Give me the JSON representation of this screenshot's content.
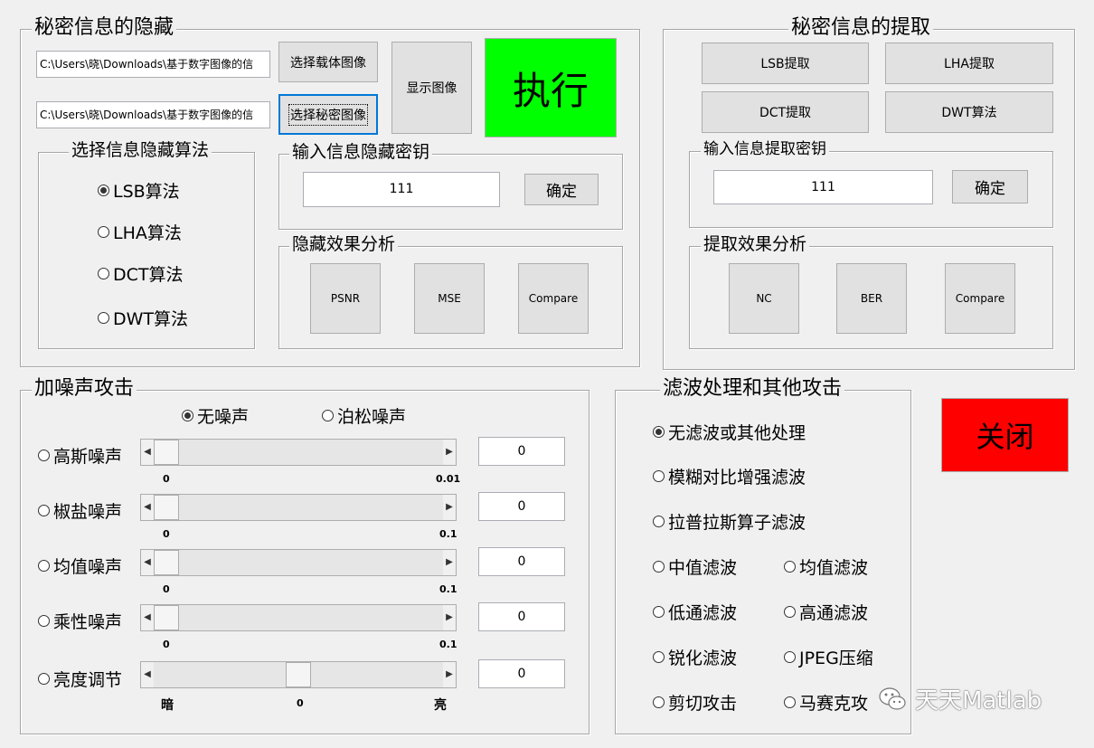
{
  "hide_panel": {
    "title": "秘密信息的隐藏",
    "carrier_path": "C:\\Users\\晓\\Downloads\\基于数字图像的信",
    "secret_path": "C:\\Users\\晓\\Downloads\\基于数字图像的信",
    "select_carrier_label": "选择载体图像",
    "select_secret_label": "选择秘密图像",
    "show_image_label": "显示图像",
    "execute_label": "执行",
    "algo_group": {
      "title": "选择信息隐藏算法",
      "options": [
        "LSB算法",
        "LHA算法",
        "DCT算法",
        "DWT算法"
      ],
      "selected": 0
    },
    "key_group": {
      "title": "输入信息隐藏密钥",
      "value": "111",
      "confirm_label": "确定"
    },
    "analysis_group": {
      "title": "隐藏效果分析",
      "buttons": [
        "PSNR",
        "MSE",
        "Compare"
      ]
    }
  },
  "extract_panel": {
    "title": "秘密信息的提取",
    "buttons": [
      "LSB提取",
      "LHA提取",
      "DCT提取",
      "DWT算法"
    ],
    "key_group": {
      "title": "输入信息提取密钥",
      "value": "111",
      "confirm_label": "确定"
    },
    "analysis_group": {
      "title": "提取效果分析",
      "buttons": [
        "NC",
        "BER",
        "Compare"
      ]
    }
  },
  "noise_panel": {
    "title": "加噪声攻击",
    "top_options": [
      "无噪声",
      "泊松噪声"
    ],
    "top_selected": 0,
    "rows": [
      {
        "label": "高斯噪声",
        "min": "0",
        "max": "0.01",
        "value": "0",
        "position": 0
      },
      {
        "label": "椒盐噪声",
        "min": "0",
        "max": "0.1",
        "value": "0",
        "position": 0
      },
      {
        "label": "均值噪声",
        "min": "0",
        "max": "0.1",
        "value": "0",
        "position": 0
      },
      {
        "label": "乘性噪声",
        "min": "0",
        "max": "0.1",
        "value": "0",
        "position": 0
      }
    ],
    "brightness": {
      "label": "亮度调节",
      "min": "暗",
      "mid": "0",
      "max": "亮",
      "value": "0",
      "position": 0.5
    }
  },
  "filter_panel": {
    "title": "滤波处理和其他攻击",
    "options": {
      "none": "无滤波或其他处理",
      "blur": "模糊对比增强滤波",
      "laplace": "拉普拉斯算子滤波",
      "median": "中值滤波",
      "mean": "均值滤波",
      "lowpass": "低通滤波",
      "highpass": "高通滤波",
      "sharpen": "锐化滤波",
      "jpeg": "JPEG压缩",
      "crop": "剪切攻击",
      "mosaic": "马赛克攻"
    },
    "selected": "none"
  },
  "close_label": "关闭",
  "watermark": "天天Matlab",
  "colors": {
    "execute_bg": "#00ff00",
    "close_bg": "#ff0000",
    "panel_bg": "#f0f0f0"
  }
}
